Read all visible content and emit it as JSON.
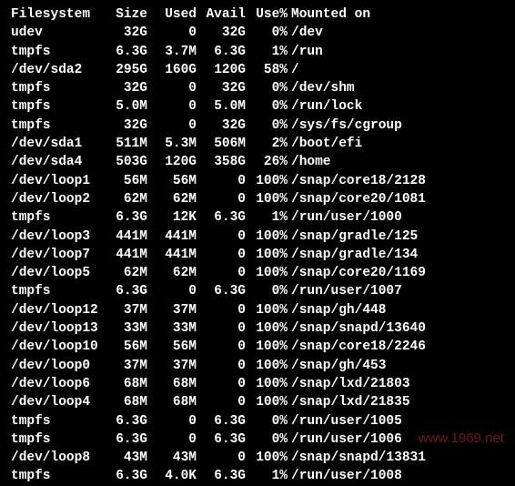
{
  "header": {
    "filesystem": "Filesystem",
    "size": "Size",
    "used": "Used",
    "avail": "Avail",
    "usep": "Use%",
    "mounted": "Mounted on"
  },
  "rows": [
    {
      "fs": "udev",
      "size": "32G",
      "used": "0",
      "avail": "32G",
      "usep": "0%",
      "mount": "/dev"
    },
    {
      "fs": "tmpfs",
      "size": "6.3G",
      "used": "3.7M",
      "avail": "6.3G",
      "usep": "1%",
      "mount": "/run"
    },
    {
      "fs": "/dev/sda2",
      "size": "295G",
      "used": "160G",
      "avail": "120G",
      "usep": "58%",
      "mount": "/"
    },
    {
      "fs": "tmpfs",
      "size": "32G",
      "used": "0",
      "avail": "32G",
      "usep": "0%",
      "mount": "/dev/shm"
    },
    {
      "fs": "tmpfs",
      "size": "5.0M",
      "used": "0",
      "avail": "5.0M",
      "usep": "0%",
      "mount": "/run/lock"
    },
    {
      "fs": "tmpfs",
      "size": "32G",
      "used": "0",
      "avail": "32G",
      "usep": "0%",
      "mount": "/sys/fs/cgroup"
    },
    {
      "fs": "/dev/sda1",
      "size": "511M",
      "used": "5.3M",
      "avail": "506M",
      "usep": "2%",
      "mount": "/boot/efi"
    },
    {
      "fs": "/dev/sda4",
      "size": "503G",
      "used": "120G",
      "avail": "358G",
      "usep": "26%",
      "mount": "/home"
    },
    {
      "fs": "/dev/loop1",
      "size": "56M",
      "used": "56M",
      "avail": "0",
      "usep": "100%",
      "mount": "/snap/core18/2128"
    },
    {
      "fs": "/dev/loop2",
      "size": "62M",
      "used": "62M",
      "avail": "0",
      "usep": "100%",
      "mount": "/snap/core20/1081"
    },
    {
      "fs": "tmpfs",
      "size": "6.3G",
      "used": "12K",
      "avail": "6.3G",
      "usep": "1%",
      "mount": "/run/user/1000"
    },
    {
      "fs": "/dev/loop3",
      "size": "441M",
      "used": "441M",
      "avail": "0",
      "usep": "100%",
      "mount": "/snap/gradle/125"
    },
    {
      "fs": "/dev/loop7",
      "size": "441M",
      "used": "441M",
      "avail": "0",
      "usep": "100%",
      "mount": "/snap/gradle/134"
    },
    {
      "fs": "/dev/loop5",
      "size": "62M",
      "used": "62M",
      "avail": "0",
      "usep": "100%",
      "mount": "/snap/core20/1169"
    },
    {
      "fs": "tmpfs",
      "size": "6.3G",
      "used": "0",
      "avail": "6.3G",
      "usep": "0%",
      "mount": "/run/user/1007"
    },
    {
      "fs": "/dev/loop12",
      "size": "37M",
      "used": "37M",
      "avail": "0",
      "usep": "100%",
      "mount": "/snap/gh/448"
    },
    {
      "fs": "/dev/loop13",
      "size": "33M",
      "used": "33M",
      "avail": "0",
      "usep": "100%",
      "mount": "/snap/snapd/13640"
    },
    {
      "fs": "/dev/loop10",
      "size": "56M",
      "used": "56M",
      "avail": "0",
      "usep": "100%",
      "mount": "/snap/core18/2246"
    },
    {
      "fs": "/dev/loop0",
      "size": "37M",
      "used": "37M",
      "avail": "0",
      "usep": "100%",
      "mount": "/snap/gh/453"
    },
    {
      "fs": "/dev/loop6",
      "size": "68M",
      "used": "68M",
      "avail": "0",
      "usep": "100%",
      "mount": "/snap/lxd/21803"
    },
    {
      "fs": "/dev/loop4",
      "size": "68M",
      "used": "68M",
      "avail": "0",
      "usep": "100%",
      "mount": "/snap/lxd/21835"
    },
    {
      "fs": "tmpfs",
      "size": "6.3G",
      "used": "0",
      "avail": "6.3G",
      "usep": "0%",
      "mount": "/run/user/1005"
    },
    {
      "fs": "tmpfs",
      "size": "6.3G",
      "used": "0",
      "avail": "6.3G",
      "usep": "0%",
      "mount": "/run/user/1006"
    },
    {
      "fs": "/dev/loop8",
      "size": "43M",
      "used": "43M",
      "avail": "0",
      "usep": "100%",
      "mount": "/snap/snapd/13831"
    },
    {
      "fs": "tmpfs",
      "size": "6.3G",
      "used": "4.0K",
      "avail": "6.3G",
      "usep": "1%",
      "mount": "/run/user/1008"
    }
  ],
  "watermark": "www.1969.net"
}
